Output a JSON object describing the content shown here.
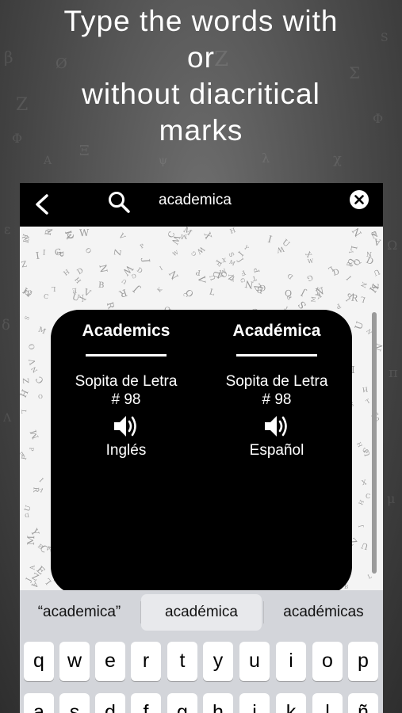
{
  "headline": {
    "line1": "Type the words with",
    "line2": "or",
    "line3": "without diacritical",
    "line4": "marks"
  },
  "search": {
    "query": "academica"
  },
  "result": {
    "left": {
      "word": "Academics",
      "source": "Sopita de Letra",
      "number": "# 98",
      "language": "Inglés"
    },
    "right": {
      "word": "Académica",
      "source": "Sopita de Letra",
      "number": "# 98",
      "language": "Español"
    }
  },
  "keyboard": {
    "suggestions": [
      "“academica”",
      "académica",
      "académicas"
    ],
    "row1": [
      "q",
      "w",
      "e",
      "r",
      "t",
      "y",
      "u",
      "i",
      "o",
      "p"
    ],
    "row2": [
      "a",
      "s",
      "d",
      "f",
      "g",
      "h",
      "j",
      "k",
      "l",
      "ñ"
    ]
  },
  "icons": [
    "back-chevron-icon",
    "search-icon",
    "clear-icon",
    "speaker-icon"
  ],
  "colors": {
    "bar": "#000000",
    "card": "#000000",
    "text": "#ffffff"
  }
}
